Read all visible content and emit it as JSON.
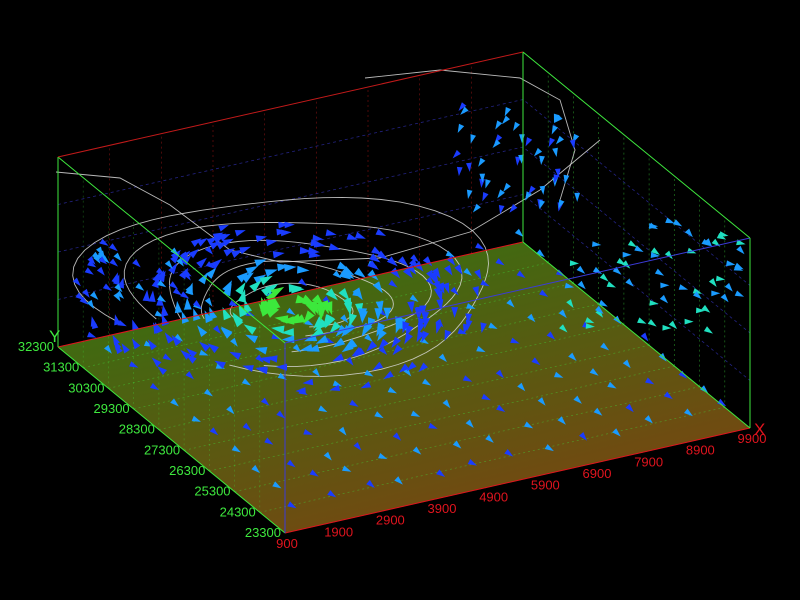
{
  "chart_data": {
    "type": "vector-field-3d",
    "xlabel": "X",
    "ylabel": "Y",
    "x_ticks": [
      900,
      1900,
      2900,
      3900,
      4900,
      5900,
      6900,
      7900,
      8900,
      9900
    ],
    "y_ticks": [
      23300,
      24300,
      25300,
      26300,
      27300,
      28300,
      29300,
      30300,
      31300,
      32300
    ],
    "xlim": [
      900,
      9900
    ],
    "ylim": [
      23300,
      32300
    ],
    "grid": true,
    "floor_gradient": [
      "#2f7d12",
      "#7d4a12"
    ],
    "vortex_center": {
      "x": 4200,
      "y": 29800
    },
    "vector_colormap": [
      "#1a3cff",
      "#1a9bff",
      "#20e0c0",
      "#3ce83c",
      "#e8e020"
    ],
    "streamline_color": "#d8d8d8",
    "colors": {
      "x_axis": "#e0141e",
      "y_axis": "#3ee83e",
      "z_edge": "#3b3bd8",
      "box_top": "#c21a1a"
    }
  }
}
